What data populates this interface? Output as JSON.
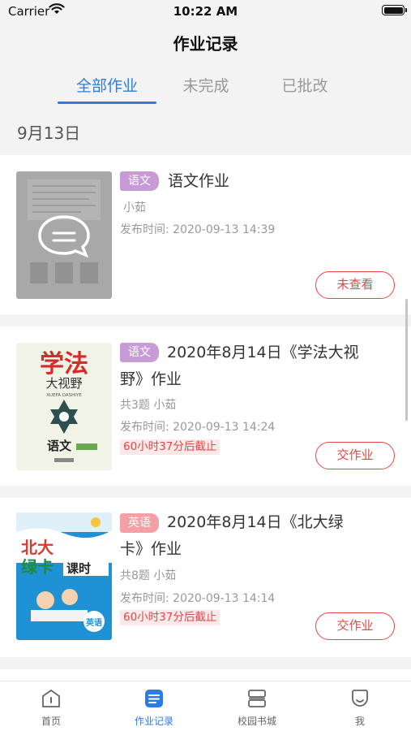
{
  "status_bar": {
    "carrier": "Carrier",
    "time": "10:22 AM"
  },
  "nav": {
    "title": "作业记录"
  },
  "tabs": [
    {
      "label": "全部作业",
      "active": true
    },
    {
      "label": "未完成",
      "active": false
    },
    {
      "label": "已批改",
      "active": false
    }
  ],
  "date_header": "9月13日",
  "cards": [
    {
      "badge": "语文",
      "title": "语文作业",
      "meta": "小茹",
      "publish_time": "发布时间: 2020-09-13 14:39",
      "deadline": "",
      "action": "未查看"
    },
    {
      "badge": "语文",
      "title_line1": "2020年8月14日《学法大视",
      "title_line2": "野》作业",
      "meta": "共3题 小茹",
      "publish_time": "发布时间: 2020-09-13 14:24",
      "deadline": "60小时37分后截止",
      "action": "交作业",
      "cover_text": {
        "big": "学法",
        "sub": "大视野",
        "roman": "XUEFA DASHIYE",
        "subject": "语文"
      }
    },
    {
      "badge": "英语",
      "title_line1": "2020年8月14日《北大绿",
      "title_line2": "卡》作业",
      "meta": "共8题 小茹",
      "publish_time": "发布时间: 2020-09-13 14:14",
      "deadline": "60小时37分后截止",
      "action": "交作业",
      "cover_text": {
        "big1": "北大",
        "big2": "绿卡",
        "sub": "课时",
        "subject": "英语"
      }
    }
  ],
  "bottom_nav": [
    {
      "label": "首页",
      "icon": "home-icon",
      "active": false
    },
    {
      "label": "作业记录",
      "icon": "homework-icon",
      "active": true
    },
    {
      "label": "校园书城",
      "icon": "bookstore-icon",
      "active": false
    },
    {
      "label": "我",
      "icon": "profile-icon",
      "active": false
    }
  ],
  "colors": {
    "accent": "#2d7de0",
    "danger": "#e64545",
    "badge_yuwen": "#c79cd6",
    "badge_yingyu": "#f4a0a4"
  }
}
